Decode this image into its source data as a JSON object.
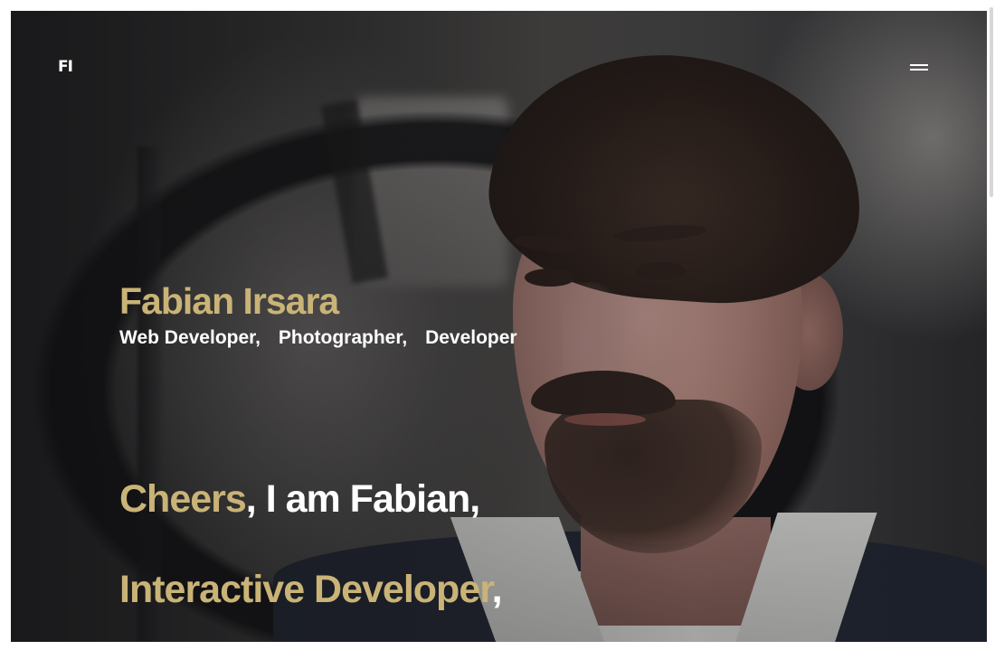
{
  "brand": {
    "logo_text": "FI"
  },
  "nav": {
    "menu_icon": "hamburger-icon"
  },
  "hero": {
    "name": "Fabian Irsara",
    "roles": [
      "Web Developer,",
      "Photographer,",
      "Developer"
    ]
  },
  "intro": {
    "greeting_highlight": "Cheers",
    "greeting_rest": ", I am Fabian,",
    "title_highlight": "Interactive Developer",
    "title_rest": ","
  },
  "colors": {
    "accent": "#c9b377",
    "text": "#ffffff"
  }
}
